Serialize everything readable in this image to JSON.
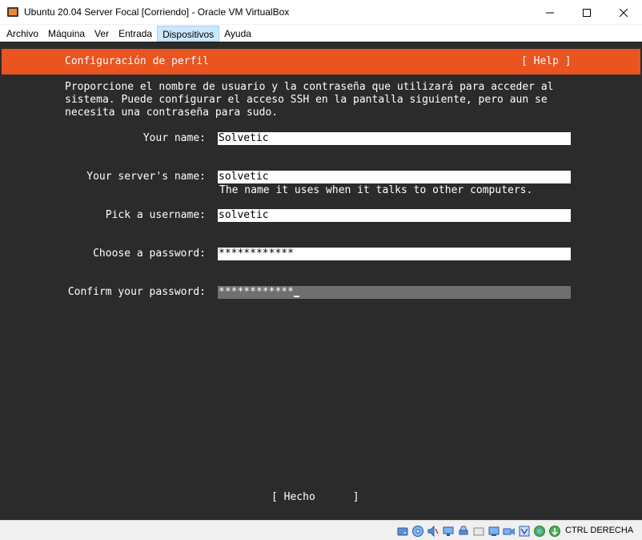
{
  "window": {
    "title": "Ubuntu 20.04 Server Focal [Corriendo] - Oracle VM VirtualBox",
    "icon": "virtualbox-icon"
  },
  "menu": {
    "items": [
      {
        "label": "Archivo"
      },
      {
        "label": "Máquina"
      },
      {
        "label": "Ver"
      },
      {
        "label": "Entrada"
      },
      {
        "label": "Dispositivos",
        "active": true
      },
      {
        "label": "Ayuda"
      }
    ]
  },
  "installer": {
    "header_title": "Configuración de perfil",
    "help_label": "[ Help ]",
    "description": "Proporcione el nombre de usuario y la contraseña que utilizará para acceder al\nsistema. Puede configurar el acceso SSH en la pantalla siguiente, pero aun se\nnecesita una contraseña para sudo.",
    "fields": {
      "your_name": {
        "label": "Your name:",
        "value": "Solvetic"
      },
      "server_name": {
        "label": "Your server's name:",
        "value": "solvetic",
        "hint": "The name it uses when it talks to other computers."
      },
      "username": {
        "label": "Pick a username:",
        "value": "solvetic"
      },
      "password": {
        "label": "Choose a password:",
        "value": "************"
      },
      "confirm_password": {
        "label": "Confirm your password:",
        "value": "************"
      }
    },
    "done_label": "[ Hecho      ]"
  },
  "statusbar": {
    "host_key": "CTRL DERECHA",
    "icons": [
      "hard-disk-icon",
      "optical-disk-icon",
      "audio-icon",
      "network-icon",
      "usb-icon",
      "shared-folder-icon",
      "display-icon",
      "video-capture-icon",
      "virtualization-icon",
      "mouse-integration-icon",
      "host-key-arrow-icon"
    ]
  },
  "colors": {
    "accent": "#e95420",
    "terminal_bg": "#2b2b2b"
  }
}
